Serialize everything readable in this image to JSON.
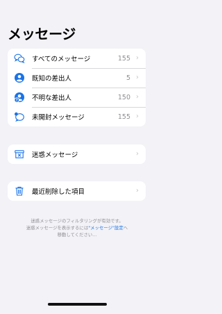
{
  "page": {
    "title": "メッセージ"
  },
  "mailboxes": [
    {
      "label": "すべてのメッセージ",
      "count": "155",
      "icon": "all-messages-icon"
    },
    {
      "label": "既知の差出人",
      "count": "5",
      "icon": "known-senders-icon"
    },
    {
      "label": "不明な差出人",
      "count": "150",
      "icon": "unknown-senders-icon"
    },
    {
      "label": "未開封メッセージ",
      "count": "155",
      "icon": "unread-messages-icon"
    }
  ],
  "junk": {
    "label": "迷惑メッセージ",
    "icon": "junk-icon"
  },
  "deleted": {
    "label": "最近削除した項目",
    "icon": "trash-icon"
  },
  "footer": {
    "line1": "迷惑メッセージのフィルタリングが有効です。",
    "line2_before": "迷惑メッセージを表示するには",
    "line2_link": "\"メッセージ\"設定",
    "line2_after": "へ",
    "line3": "移動してください..."
  },
  "colors": {
    "accent": "#1a73e8",
    "background": "#f2f2f7"
  }
}
